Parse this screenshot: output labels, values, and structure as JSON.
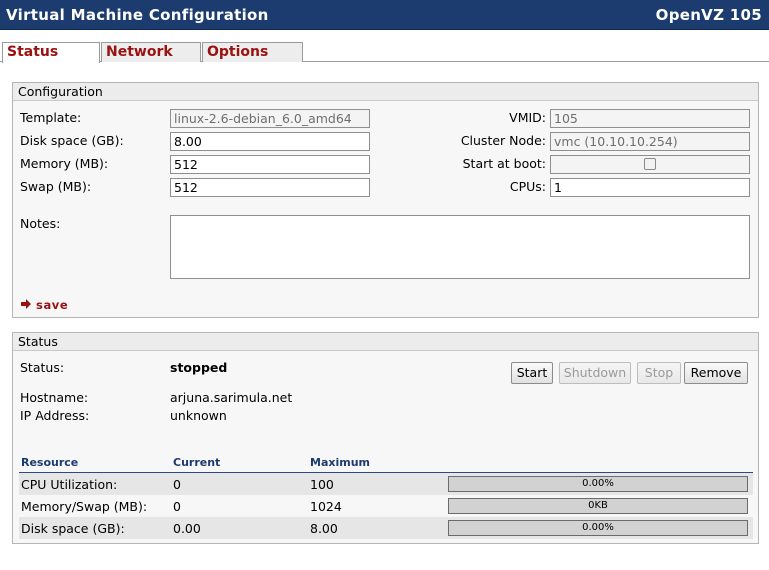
{
  "header": {
    "title": "Virtual Machine Configuration",
    "vm_label": "OpenVZ 105"
  },
  "tabs": [
    {
      "label": "Status",
      "active": true
    },
    {
      "label": "Network",
      "active": false
    },
    {
      "label": "Options",
      "active": false
    }
  ],
  "configuration": {
    "title": "Configuration",
    "template": {
      "label": "Template:",
      "value": "linux-2.6-debian_6.0_amd64"
    },
    "disk_space": {
      "label": "Disk space (GB):",
      "value": "8.00"
    },
    "memory": {
      "label": "Memory (MB):",
      "value": "512"
    },
    "swap": {
      "label": "Swap (MB):",
      "value": "512"
    },
    "vmid": {
      "label": "VMID:",
      "value": "105"
    },
    "cluster_node": {
      "label": "Cluster Node:",
      "value": "vmc (10.10.10.254)"
    },
    "start_at_boot": {
      "label": "Start at boot:",
      "checked": false
    },
    "cpus": {
      "label": "CPUs:",
      "value": "1"
    },
    "notes": {
      "label": "Notes:",
      "value": ""
    },
    "save_label": "save"
  },
  "status": {
    "title": "Status",
    "status_label": "Status:",
    "status_value": "stopped",
    "hostname_label": "Hostname:",
    "hostname_value": "arjuna.sarimula.net",
    "ip_label": "IP Address:",
    "ip_value": "unknown",
    "buttons": {
      "start": "Start",
      "shutdown": "Shutdown",
      "stop": "Stop",
      "remove": "Remove"
    },
    "resources": {
      "headers": {
        "resource": "Resource",
        "current": "Current",
        "maximum": "Maximum"
      },
      "rows": [
        {
          "name": "CPU Utilization:",
          "current": "0",
          "maximum": "100",
          "usage_text": "0.00%",
          "usage_fraction": 0
        },
        {
          "name": "Memory/Swap (MB):",
          "current": "0",
          "maximum": "1024",
          "usage_text": "0KB",
          "usage_fraction": 0
        },
        {
          "name": "Disk space (GB):",
          "current": "0.00",
          "maximum": "8.00",
          "usage_text": "0.00%",
          "usage_fraction": 0
        }
      ]
    }
  },
  "colors": {
    "titlebar": "#1c3b6e",
    "tab_text": "#9b1010",
    "save_text": "#9b1010",
    "resource_header": "#1c3b6e"
  }
}
